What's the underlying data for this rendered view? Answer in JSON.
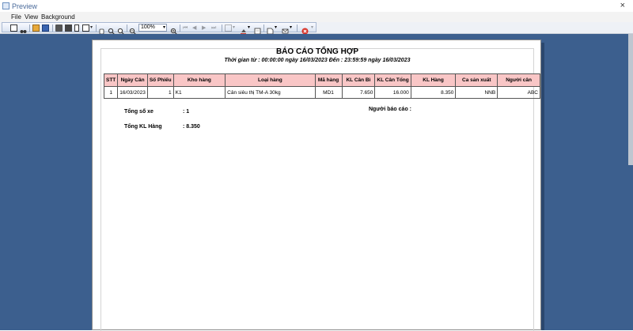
{
  "window": {
    "title": "Preview",
    "close_glyph": "×"
  },
  "menu": {
    "items": [
      "File",
      "View",
      "Background"
    ]
  },
  "toolbar": {
    "zoom_value": "100%"
  },
  "report": {
    "title": "BÁO CÁO TỔNG HỢP",
    "subtitle": "Thời gian từ : 00:00:00 ngày 16/03/2023 Đến : 23:59:59 ngày 16/03/2023",
    "columns": [
      "STT",
      "Ngày Cân",
      "Số Phiếu",
      "Kho hàng",
      "Loại hàng",
      "Mã hàng",
      "KL Cân Bì",
      "KL Cân Tổng",
      "KL Hàng",
      "Ca sản xuất",
      "Người cân"
    ],
    "rows": [
      [
        "1",
        "16/03/2023",
        "1",
        "K1",
        "Cân siêu thị TM-A 30kg",
        "MD1",
        "7.650",
        "16.000",
        "8.350",
        "NNB",
        "ABC"
      ]
    ],
    "summary": {
      "vehicles_label": "Tổng số xe",
      "vehicles_value": ": 1",
      "weight_label": "Tổng KL Hàng",
      "weight_value": ": 8.350",
      "reporter_label": "Người báo cáo :"
    }
  }
}
